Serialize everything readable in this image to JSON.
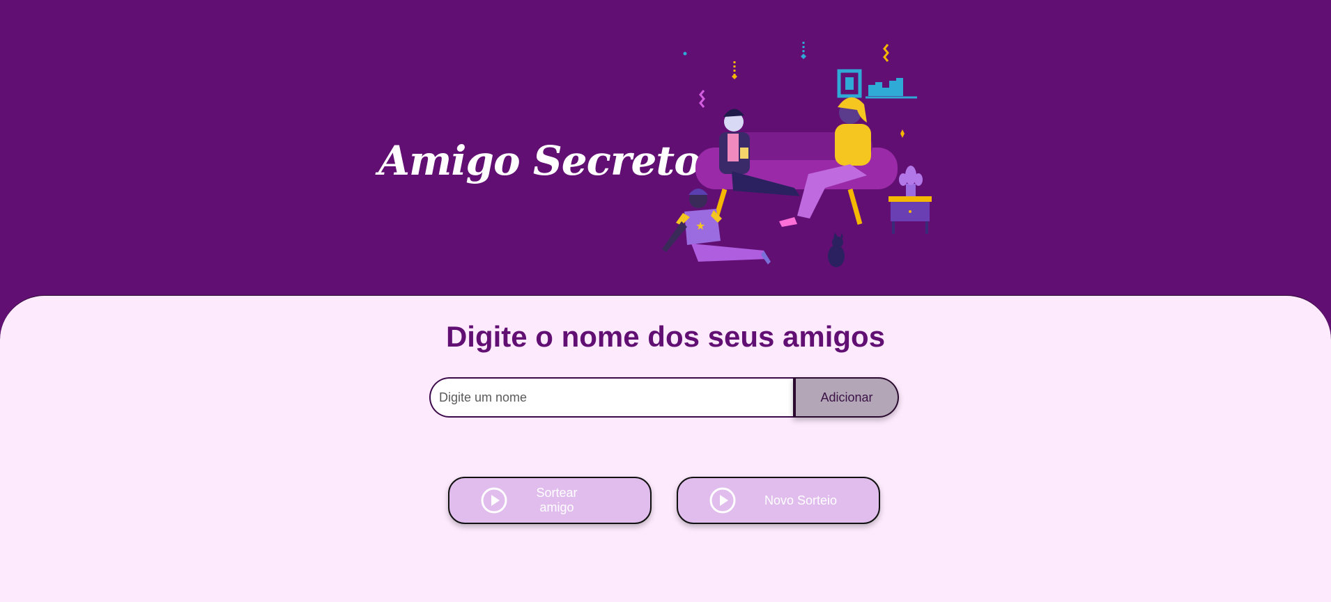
{
  "header": {
    "title": "Amigo Secreto"
  },
  "main": {
    "section_title": "Digite o nome dos seus amigos",
    "input": {
      "placeholder": "Digite um nome",
      "value": ""
    },
    "add_button_label": "Adicionar",
    "draw_button_label_line1": "Sortear",
    "draw_button_label_line2": "amigo",
    "reset_button_label": "Novo Sorteio"
  },
  "colors": {
    "header_background": "#620f74",
    "main_background": "#fdeafd",
    "title_text": "#620f74",
    "add_button": "#b3a6b7",
    "action_button": "#e1bdee"
  },
  "icons": {
    "draw_button_icon": "play-circle-icon",
    "reset_button_icon": "play-circle-icon"
  }
}
